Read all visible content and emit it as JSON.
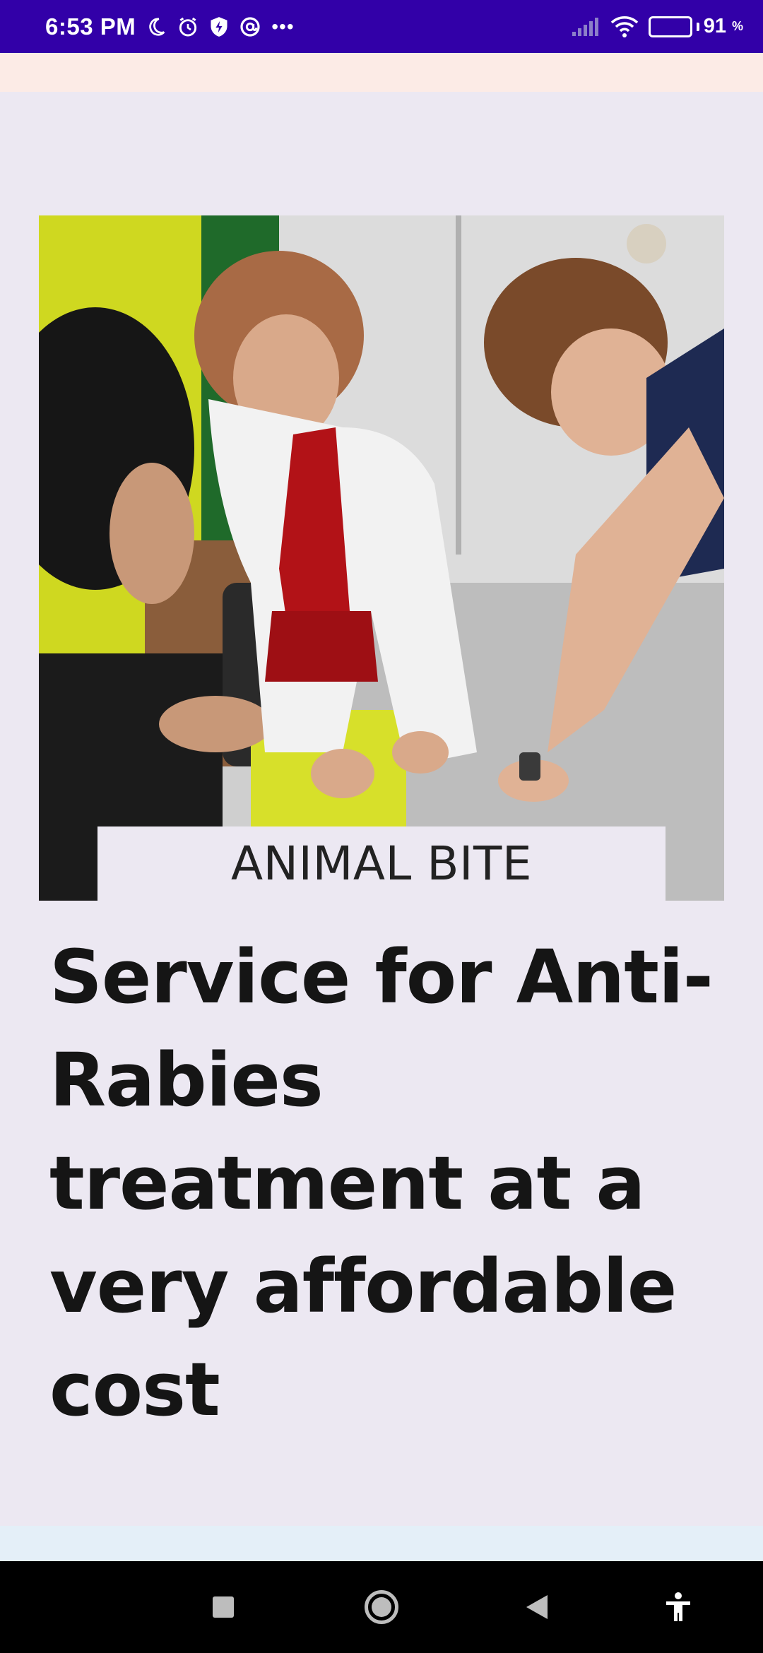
{
  "status_bar": {
    "time": "6:53 PM",
    "battery_level": "91",
    "battery_unit": "%",
    "icons": [
      "moon-icon",
      "alarm-icon",
      "shield-icon",
      "at-sign-icon",
      "more-dots-icon",
      "signal-icon",
      "wifi-icon",
      "battery-charging-icon"
    ]
  },
  "hero": {
    "image_caption": "ANIMAL BITE"
  },
  "headline": {
    "text": "Service for Anti-Rabies treatment at a very affordable cost"
  },
  "nav_bar": {
    "icons": [
      "recent-apps-icon",
      "home-icon",
      "back-icon",
      "accessibility-icon"
    ]
  },
  "colors": {
    "status_bar": "#3200a8",
    "page_background": "#ece8f2",
    "top_strip": "#fcebe6",
    "bottom_strip": "#e4eff8",
    "headline_text": "#151515",
    "nav_bar": "#000000"
  }
}
